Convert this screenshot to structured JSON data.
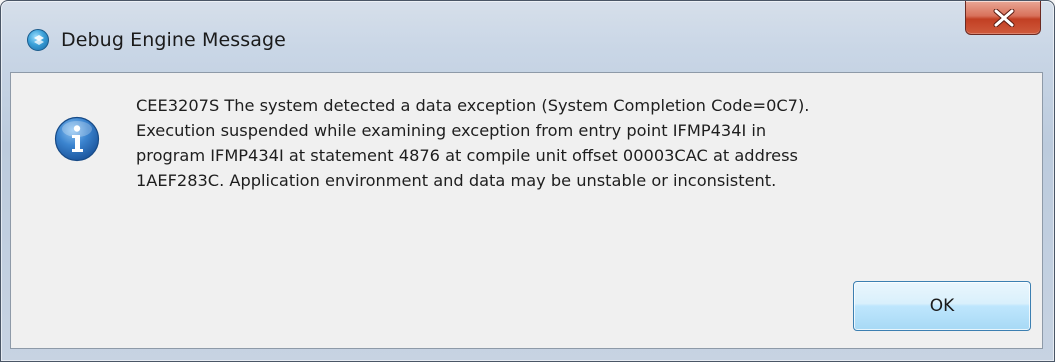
{
  "window": {
    "title": "Debug Engine Message",
    "app_icon": "debug-engine-icon",
    "close_icon": "close-icon",
    "close_button_color": "#c94a2c"
  },
  "message": {
    "icon": "info-icon",
    "icon_color": "#2a6fb4",
    "lines": [
      "CEE3207S The system detected a data exception (System Completion Code=0C7).",
      "Execution suspended while examining exception from entry point IFMP434I in",
      "program IFMP434I at statement 4876 at compile unit offset 00003CAC at address",
      "1AEF283C. Application environment and data may be unstable or inconsistent."
    ]
  },
  "buttons": {
    "ok_label": "OK"
  }
}
